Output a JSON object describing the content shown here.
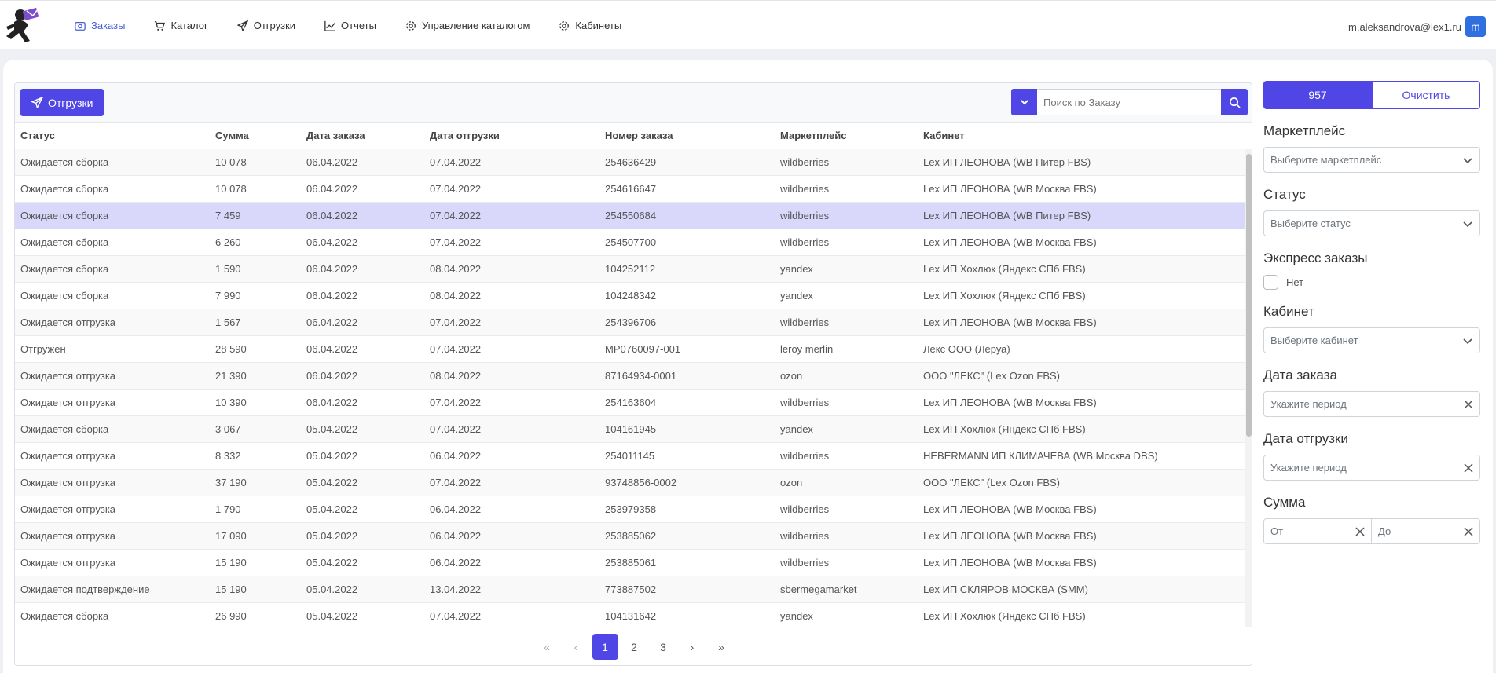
{
  "nav": {
    "items": [
      {
        "label": "Заказы",
        "icon": "camera-icon",
        "active": true
      },
      {
        "label": "Каталог",
        "icon": "cart-icon",
        "active": false
      },
      {
        "label": "Отгрузки",
        "icon": "send-icon",
        "active": false
      },
      {
        "label": "Отчеты",
        "icon": "chart-icon",
        "active": false
      },
      {
        "label": "Управление каталогом",
        "icon": "gear-icon",
        "active": false
      },
      {
        "label": "Кабинеты",
        "icon": "gear-icon",
        "active": false
      }
    ],
    "user_email": "m.aleksandrova@lex1.ru",
    "avatar_letter": "m"
  },
  "toolbar": {
    "shipments_button": "Отгрузки",
    "search_placeholder": "Поиск по Заказу"
  },
  "table": {
    "headers": [
      "Статус",
      "Сумма",
      "Дата заказа",
      "Дата отгрузки",
      "Номер заказа",
      "Маркетплейс",
      "Кабинет"
    ],
    "selected_row": 2,
    "rows": [
      [
        "Ожидается сборка",
        "10 078",
        "06.04.2022",
        "07.04.2022",
        "254636429",
        "wildberries",
        "Lex ИП ЛЕОНОВА (WB Питер FBS)"
      ],
      [
        "Ожидается сборка",
        "10 078",
        "06.04.2022",
        "07.04.2022",
        "254616647",
        "wildberries",
        "Lex ИП ЛЕОНОВА (WB Москва FBS)"
      ],
      [
        "Ожидается сборка",
        "7 459",
        "06.04.2022",
        "07.04.2022",
        "254550684",
        "wildberries",
        "Lex ИП ЛЕОНОВА (WB Питер FBS)"
      ],
      [
        "Ожидается сборка",
        "6 260",
        "06.04.2022",
        "07.04.2022",
        "254507700",
        "wildberries",
        "Lex ИП ЛЕОНОВА (WB Москва FBS)"
      ],
      [
        "Ожидается сборка",
        "1 590",
        "06.04.2022",
        "08.04.2022",
        "104252112",
        "yandex",
        "Lex ИП Хохлюк (Яндекс СПб FBS)"
      ],
      [
        "Ожидается сборка",
        "7 990",
        "06.04.2022",
        "08.04.2022",
        "104248342",
        "yandex",
        "Lex ИП Хохлюк (Яндекс СПб FBS)"
      ],
      [
        "Ожидается отгрузка",
        "1 567",
        "06.04.2022",
        "07.04.2022",
        "254396706",
        "wildberries",
        "Lex ИП ЛЕОНОВА (WB Москва FBS)"
      ],
      [
        "Отгружен",
        "28 590",
        "06.04.2022",
        "07.04.2022",
        "MP0760097-001",
        "leroy merlin",
        "Лекс ООО (Леруа)"
      ],
      [
        "Ожидается отгрузка",
        "21 390",
        "06.04.2022",
        "08.04.2022",
        "87164934-0001",
        "ozon",
        "ООО \"ЛЕКС\" (Lex Ozon FBS)"
      ],
      [
        "Ожидается отгрузка",
        "10 390",
        "06.04.2022",
        "07.04.2022",
        "254163604",
        "wildberries",
        "Lex ИП ЛЕОНОВА (WB Москва FBS)"
      ],
      [
        "Ожидается сборка",
        "3 067",
        "05.04.2022",
        "07.04.2022",
        "104161945",
        "yandex",
        "Lex ИП Хохлюк (Яндекс СПб FBS)"
      ],
      [
        "Ожидается отгрузка",
        "8 332",
        "05.04.2022",
        "06.04.2022",
        "254011145",
        "wildberries",
        "HEBERMANN ИП КЛИМАЧЕВА (WB Москва DBS)"
      ],
      [
        "Ожидается отгрузка",
        "37 190",
        "05.04.2022",
        "07.04.2022",
        "93748856-0002",
        "ozon",
        "ООО \"ЛЕКС\" (Lex Ozon FBS)"
      ],
      [
        "Ожидается отгрузка",
        "1 790",
        "05.04.2022",
        "06.04.2022",
        "253979358",
        "wildberries",
        "Lex ИП ЛЕОНОВА (WB Москва FBS)"
      ],
      [
        "Ожидается отгрузка",
        "17 090",
        "05.04.2022",
        "06.04.2022",
        "253885062",
        "wildberries",
        "Lex ИП ЛЕОНОВА (WB Москва FBS)"
      ],
      [
        "Ожидается отгрузка",
        "15 190",
        "05.04.2022",
        "06.04.2022",
        "253885061",
        "wildberries",
        "Lex ИП ЛЕОНОВА (WB Москва FBS)"
      ],
      [
        "Ожидается подтверждение",
        "15 190",
        "05.04.2022",
        "13.04.2022",
        "773887502",
        "sbermegamarket",
        "Lex ИП СКЛЯРОВ МОСКВА (SMM)"
      ],
      [
        "Ожидается сборка",
        "26 990",
        "05.04.2022",
        "07.04.2022",
        "104131642",
        "yandex",
        "Lex ИП Хохлюк (Яндекс СПб FBS)"
      ]
    ]
  },
  "pagination": {
    "first": "«",
    "prev": "‹",
    "pages": [
      "1",
      "2",
      "3"
    ],
    "current": "1",
    "next": "›",
    "last": "»"
  },
  "filters": {
    "count": "957",
    "clear": "Очистить",
    "marketplace_label": "Маркетплейс",
    "marketplace_placeholder": "Выберите маркетплейс",
    "status_label": "Статус",
    "status_placeholder": "Выберите статус",
    "express_label": "Экспресс заказы",
    "express_value": "Нет",
    "cabinet_label": "Кабинет",
    "cabinet_placeholder": "Выберите кабинет",
    "order_date_label": "Дата заказа",
    "order_date_placeholder": "Укажите период",
    "ship_date_label": "Дата отгрузки",
    "ship_date_placeholder": "Укажите период",
    "sum_label": "Сумма",
    "sum_from": "От",
    "sum_to": "До"
  },
  "colors": {
    "accent": "#4f46e5",
    "nav_active": "#4a5fd9",
    "selected_row": "#d9d8fb"
  }
}
